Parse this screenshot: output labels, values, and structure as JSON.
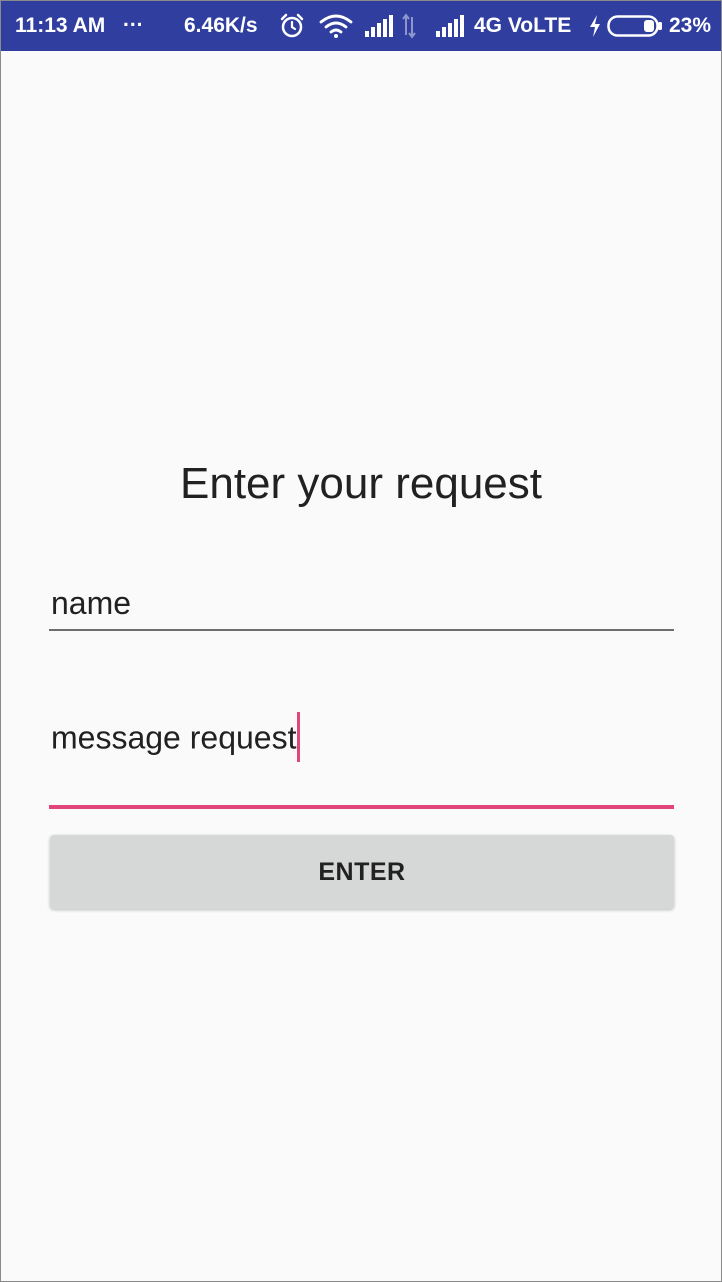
{
  "status_bar": {
    "time": "11:13 AM",
    "more": "...",
    "speed": "6.46K/s",
    "network": "4G VoLTE",
    "battery_percent": "23%",
    "battery_level": 0.23,
    "background": "#303f9f"
  },
  "form": {
    "title": "Enter your request",
    "name_field": {
      "value": "name"
    },
    "message_field": {
      "value": "message request",
      "accent_color": "#e0457b"
    },
    "enter_button": {
      "label": "ENTER"
    }
  }
}
